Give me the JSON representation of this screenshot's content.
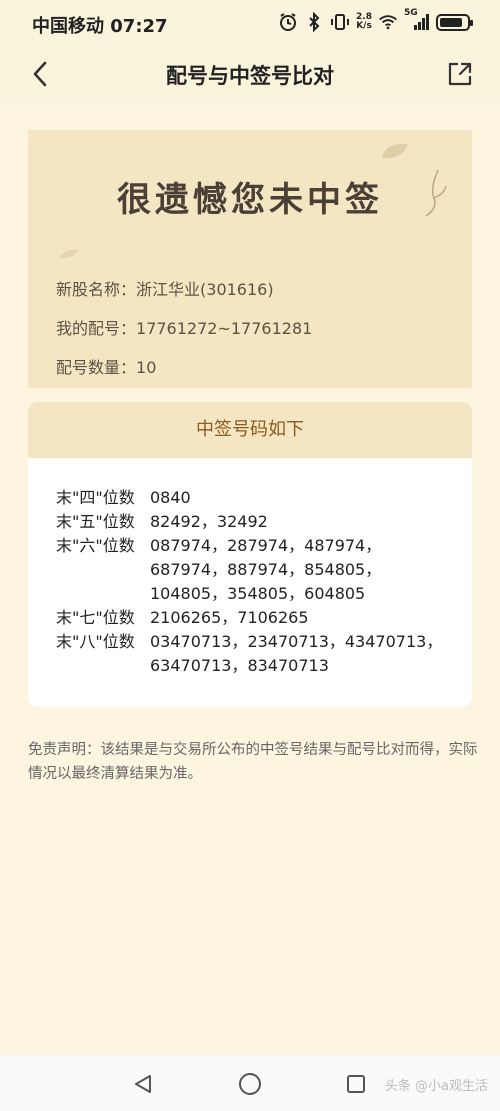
{
  "status_bar": {
    "carrier_time": "中国移动 07:27",
    "speed_value": "2.8",
    "speed_unit": "K/s",
    "network": "5G"
  },
  "header": {
    "title": "配号与中签号比对"
  },
  "result": {
    "heading": "很遗憾您未中签",
    "info": [
      {
        "label": "新股名称：",
        "value": "浙江华业(301616)"
      },
      {
        "label": "我的配号：",
        "value": "17761272~17761281"
      },
      {
        "label": "配号数量：",
        "value": "10"
      }
    ]
  },
  "winning_numbers": {
    "header": "中签号码如下",
    "rows": [
      {
        "label": "末\"四\"位数",
        "values": "0840"
      },
      {
        "label": "末\"五\"位数",
        "values": "82492，32492"
      },
      {
        "label": "末\"六\"位数",
        "values": "087974，287974，487974，687974，887974，854805，104805，354805，604805"
      },
      {
        "label": "末\"七\"位数",
        "values": "2106265，7106265"
      },
      {
        "label": "末\"八\"位数",
        "values": "03470713，23470713，43470713，63470713，83470713"
      }
    ]
  },
  "disclaimer": "免责声明：该结果是与交易所公布的中签号结果与配号比对而得，实际情况以最终清算结果为准。",
  "watermark": "头条 @小a观生活",
  "colors": {
    "background": "#fdf5e0",
    "card": "#f4e6c3",
    "accent": "#8a5a1f"
  }
}
